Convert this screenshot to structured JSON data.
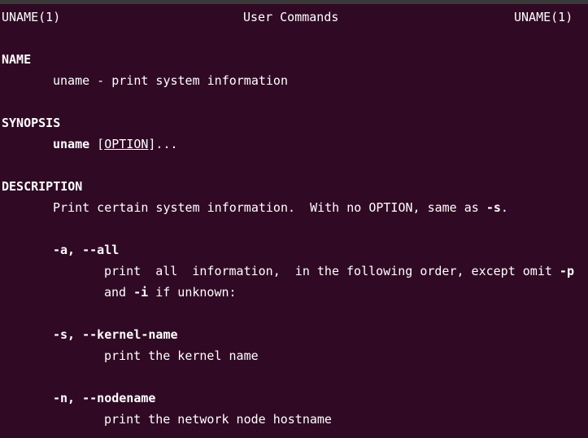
{
  "header": {
    "left": "UNAME(1)",
    "center": "User Commands",
    "right": "UNAME(1)"
  },
  "sections": {
    "name": {
      "heading": "NAME",
      "text": "uname - print system information"
    },
    "synopsis": {
      "heading": "SYNOPSIS",
      "command": "uname",
      "open_bracket": " [",
      "option": "OPTION",
      "close": "]..."
    },
    "description": {
      "heading": "DESCRIPTION",
      "intro_before": "Print certain system information.  With no OPTION, same as ",
      "intro_flag": "-s",
      "intro_after": ".",
      "options": [
        {
          "flags": "-a, --all",
          "line1_before": "print  all  information,  in the following order, except omit ",
          "line1_flag": "-p",
          "line2_start": "and ",
          "line2_flag": "-i",
          "line2_after": " if unknown:"
        },
        {
          "flags": "-s, --kernel-name",
          "text": "print the kernel name"
        },
        {
          "flags": "-n, --nodename",
          "text": "print the network node hostname"
        }
      ]
    }
  },
  "colors": {
    "background": "#300a24",
    "foreground": "#ffffff"
  }
}
